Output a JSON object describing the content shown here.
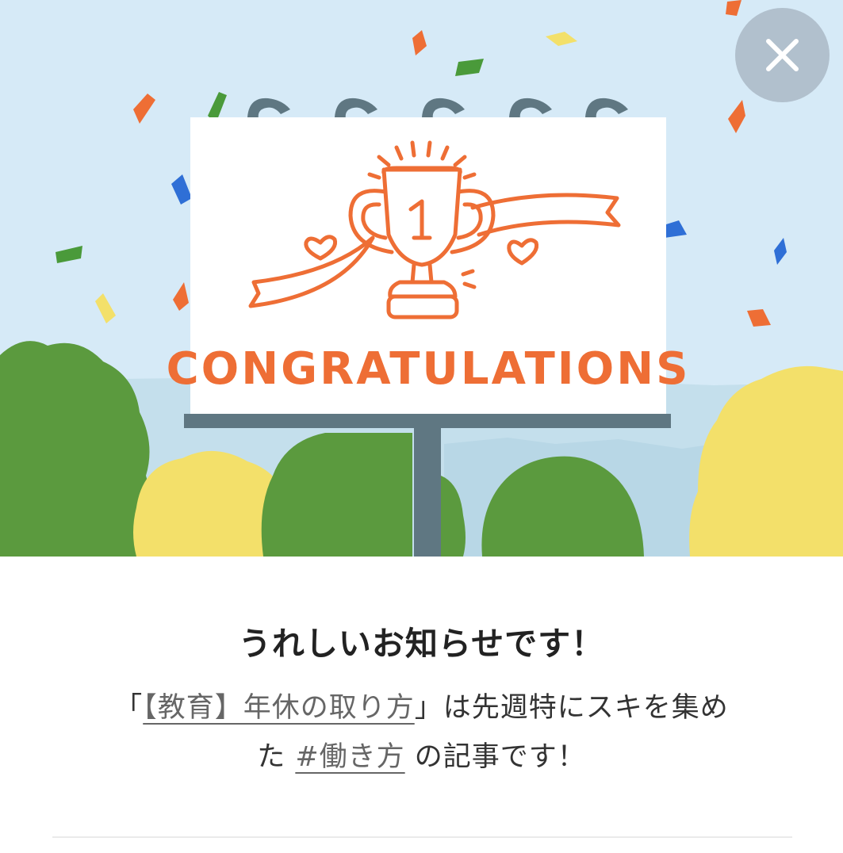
{
  "banner": {
    "sign_text": "CONGRATULATIONS",
    "trophy_number": "1"
  },
  "close": {
    "icon": "close-icon"
  },
  "notice": {
    "title": "うれしいお知らせです！",
    "open_quote": "「",
    "article_link": "【教育】年休の取り方",
    "close_quote_mid": "」は先週特にスキを集め",
    "line2_prefix": "た ",
    "hashtag_link": "#働き方",
    "line2_suffix": " の記事です！"
  },
  "colors": {
    "sky": "#D6EAF7",
    "sign_orange": "#EE6E35",
    "tree_green": "#5B9A3E",
    "tree_yellow": "#F3E06A",
    "post_gray": "#5F7782",
    "close_bg": "#AAB9C6"
  }
}
